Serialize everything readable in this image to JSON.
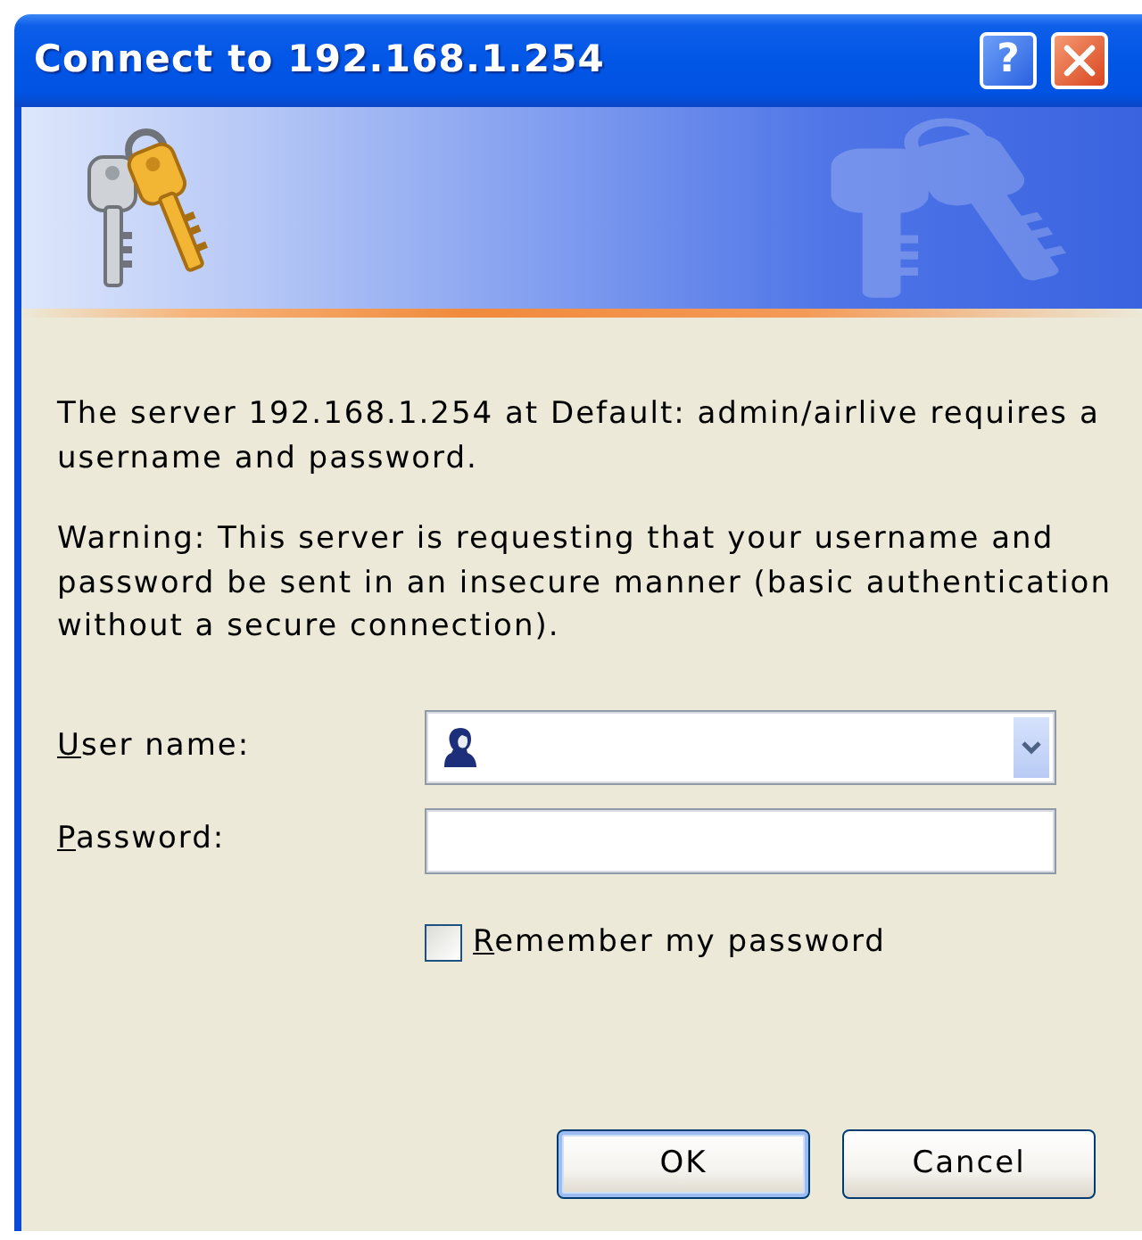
{
  "window": {
    "title": "Connect to 192.168.1.254",
    "title_buttons": [
      {
        "kind": "help",
        "label": "?"
      },
      {
        "kind": "close"
      }
    ]
  },
  "messages": [
    "The server 192.168.1.254 at Default: admin/airlive requires a username and password.",
    "Warning: This server is requesting that your username and password be sent in an insecure manner (basic authentication without a secure connection)."
  ],
  "fields": [
    {
      "kind": "combo",
      "label": "User name:"
    },
    {
      "kind": "password",
      "label": "Password:"
    }
  ],
  "remember": {
    "label": "Remember my password",
    "checked": false
  },
  "buttons": [
    {
      "label": "OK",
      "default": true
    },
    {
      "label": "Cancel",
      "default": false
    }
  ]
}
